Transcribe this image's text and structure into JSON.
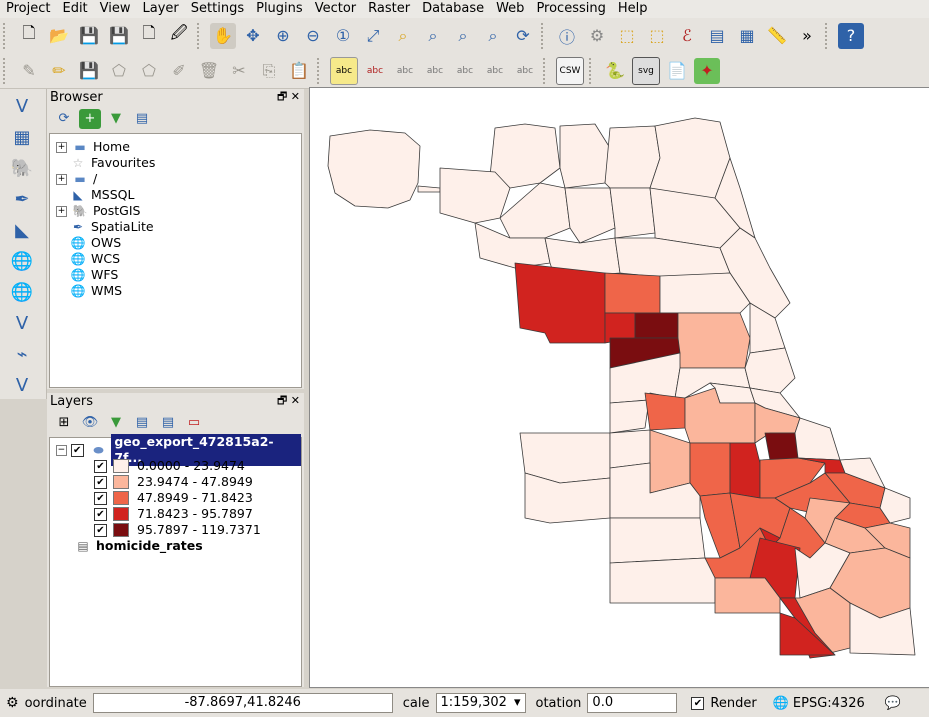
{
  "menu": [
    "Project",
    "Edit",
    "View",
    "Layer",
    "Settings",
    "Plugins",
    "Vector",
    "Raster",
    "Database",
    "Web",
    "Processing",
    "Help"
  ],
  "browser": {
    "title": "Browser",
    "items": [
      {
        "label": "Home",
        "icon": "folder-icon",
        "expandable": true
      },
      {
        "label": "Favourites",
        "icon": "star-icon",
        "expandable": false
      },
      {
        "label": "/",
        "icon": "folder-icon",
        "expandable": true
      },
      {
        "label": "MSSQL",
        "icon": "mssql-icon",
        "expandable": false
      },
      {
        "label": "PostGIS",
        "icon": "postgis-icon",
        "expandable": true
      },
      {
        "label": "SpatiaLite",
        "icon": "spatialite-icon",
        "expandable": false
      },
      {
        "label": "OWS",
        "icon": "globe-icon",
        "expandable": false
      },
      {
        "label": "WCS",
        "icon": "globe-icon",
        "expandable": false
      },
      {
        "label": "WFS",
        "icon": "globe-icon",
        "expandable": false
      },
      {
        "label": "WMS",
        "icon": "globe-icon",
        "expandable": false
      }
    ]
  },
  "layers": {
    "title": "Layers",
    "layer_name": "geo_export_472815a2-7f...",
    "classes": [
      {
        "label": "0.0000 - 23.9474",
        "color": "#fef0ea"
      },
      {
        "label": "23.9474 - 47.8949",
        "color": "#fbb69c"
      },
      {
        "label": "47.8949 - 71.8423",
        "color": "#ef6549"
      },
      {
        "label": "71.8423 - 95.7897",
        "color": "#d1231f"
      },
      {
        "label": "95.7897 - 119.7371",
        "color": "#7a0d10"
      }
    ],
    "table_name": "homicide_rates"
  },
  "status": {
    "coordinate_label": "oordinate",
    "coordinate_value": "-87.8697,41.8246",
    "scale_label": "cale",
    "scale_value": "1:159,302",
    "rotation_label": "otation",
    "rotation_value": "0.0",
    "render_label": "Render",
    "crs_label": "EPSG:4326"
  }
}
